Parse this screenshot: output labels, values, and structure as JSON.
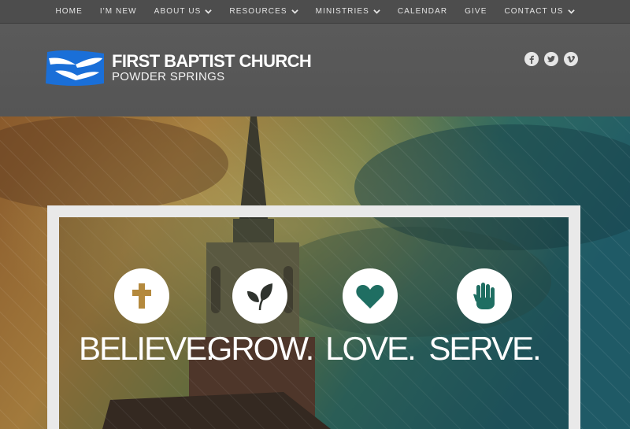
{
  "nav": {
    "items": [
      {
        "label": "HOME",
        "has_dropdown": false
      },
      {
        "label": "I'M NEW",
        "has_dropdown": false
      },
      {
        "label": "ABOUT US",
        "has_dropdown": true
      },
      {
        "label": "RESOURCES",
        "has_dropdown": true
      },
      {
        "label": "MINISTRIES",
        "has_dropdown": true
      },
      {
        "label": "CALENDAR",
        "has_dropdown": false
      },
      {
        "label": "GIVE",
        "has_dropdown": false
      },
      {
        "label": "CONTACT US",
        "has_dropdown": true
      }
    ]
  },
  "logo": {
    "title": "FIRST BAPTIST CHURCH",
    "subtitle": "POWDER SPRINGS",
    "colors": {
      "blue": "#1a6fd8",
      "white": "#ffffff"
    }
  },
  "social": [
    {
      "icon": "facebook-icon"
    },
    {
      "icon": "twitter-icon"
    },
    {
      "icon": "vimeo-icon"
    }
  ],
  "hero": {
    "values": [
      {
        "label": "BELIEVE.",
        "icon": "cross-icon"
      },
      {
        "label": "GROW.",
        "icon": "leaf-icon"
      },
      {
        "label": "LOVE.",
        "icon": "heart-icon"
      },
      {
        "label": "SERVE.",
        "icon": "hand-icon"
      }
    ],
    "icon_color": "#b4893d"
  }
}
